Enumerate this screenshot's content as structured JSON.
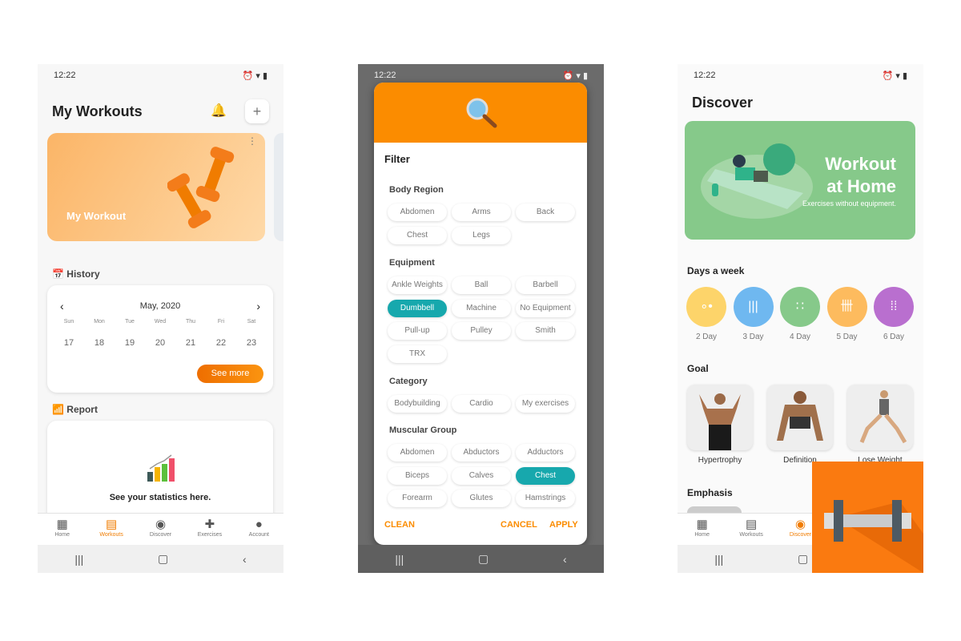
{
  "status": {
    "time": "12:22"
  },
  "workouts": {
    "title": "My Workouts",
    "card_title": "My Workout",
    "history_label": "History",
    "month": "May, 2020",
    "weekdays": [
      "Sun",
      "Mon",
      "Tue",
      "Wed",
      "Thu",
      "Fri",
      "Sat"
    ],
    "dates": [
      "17",
      "18",
      "19",
      "20",
      "21",
      "22",
      "23"
    ],
    "see_more": "See more",
    "report_label": "Report",
    "report_text": "See your statistics here."
  },
  "nav": [
    "Home",
    "Workouts",
    "Discover",
    "Exercises",
    "Account"
  ],
  "filter": {
    "title": "Filter",
    "sections": [
      {
        "label": "Body Region",
        "items": [
          "Abdomen",
          "Arms",
          "Back",
          "Chest",
          "Legs"
        ],
        "selected": []
      },
      {
        "label": "Equipment",
        "items": [
          "Ankle Weights",
          "Ball",
          "Barbell",
          "Dumbbell",
          "Machine",
          "No Equipment",
          "Pull-up",
          "Pulley",
          "Smith",
          "TRX"
        ],
        "selected": [
          "Dumbbell"
        ]
      },
      {
        "label": "Category",
        "items": [
          "Bodybuilding",
          "Cardio",
          "My exercises"
        ],
        "selected": []
      },
      {
        "label": "Muscular Group",
        "items": [
          "Abdomen",
          "Abductors",
          "Adductors",
          "Biceps",
          "Calves",
          "Chest",
          "Forearm",
          "Glutes",
          "Hamstrings"
        ],
        "selected": [
          "Chest"
        ]
      }
    ],
    "clean": "CLEAN",
    "cancel": "CANCEL",
    "apply": "APPLY"
  },
  "discover": {
    "title": "Discover",
    "banner_title_1": "Workout",
    "banner_title_2": "at Home",
    "banner_subtitle": "Exercises without equipment.",
    "days_label": "Days a week",
    "days": [
      {
        "label": "2 Day",
        "color": "#fdd46a"
      },
      {
        "label": "3 Day",
        "color": "#6fb8f0"
      },
      {
        "label": "4 Day",
        "color": "#86c98a"
      },
      {
        "label": "5 Day",
        "color": "#fdbb5e"
      },
      {
        "label": "6 Day",
        "color": "#b96fcf"
      }
    ],
    "goal_label": "Goal",
    "goals": [
      "Hypertrophy",
      "Definition",
      "Lose Weight"
    ],
    "emphasis_label": "Emphasis"
  },
  "colors": {
    "accent": "#f07c00",
    "selected_chip": "#17a8ad",
    "banner": "#86c98a"
  }
}
